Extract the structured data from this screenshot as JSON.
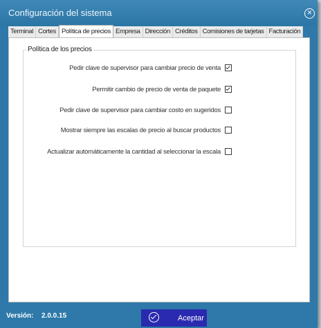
{
  "window": {
    "title": "Configuración del sistema"
  },
  "tabs": [
    {
      "label": "Terminal"
    },
    {
      "label": "Cortes"
    },
    {
      "label": "Política de precios",
      "active": true
    },
    {
      "label": "Empresa"
    },
    {
      "label": "Dirección"
    },
    {
      "label": "Créditos"
    },
    {
      "label": "Comisiones de tarjetas"
    },
    {
      "label": "Facturación"
    }
  ],
  "group": {
    "title": "Política de los precios",
    "options": [
      {
        "label": "Pedir clave de supervisor para cambiar precio de venta",
        "checked": true
      },
      {
        "label": "Permitir cambio de precio de venta de paquete",
        "checked": true
      },
      {
        "label": "Pedir clave de supervisor para cambiar costo en sugeridos",
        "checked": false
      },
      {
        "label": "Mostrar siempre las escalas de precio al buscar productos",
        "checked": false
      },
      {
        "label": "Actualizar automáticamente la cantidad al seleccionar la escala",
        "checked": false
      }
    ]
  },
  "footer": {
    "version_label": "Versión:",
    "version_value": "2.0.0.15",
    "accept_label": "Aceptar"
  },
  "icons": {
    "close": "close-circle-icon",
    "accept": "check-circle-icon"
  },
  "colors": {
    "titlebar": "#2e79a9",
    "accept_button": "#2a2ab0"
  }
}
